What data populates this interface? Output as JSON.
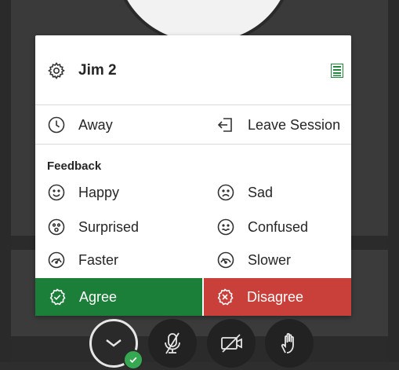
{
  "user": {
    "name": "Jim 2"
  },
  "status": {
    "away_label": "Away",
    "leave_label": "Leave Session"
  },
  "feedback": {
    "section_label": "Feedback",
    "items": [
      {
        "label": "Happy",
        "icon": "happy-icon"
      },
      {
        "label": "Sad",
        "icon": "sad-icon"
      },
      {
        "label": "Surprised",
        "icon": "surprised-icon"
      },
      {
        "label": "Confused",
        "icon": "confused-icon"
      },
      {
        "label": "Faster",
        "icon": "faster-icon"
      },
      {
        "label": "Slower",
        "icon": "slower-icon"
      }
    ],
    "agree_label": "Agree",
    "disagree_label": "Disagree"
  },
  "colors": {
    "agree": "#1b7f3a",
    "disagree": "#c9403a",
    "status_ok": "#36a852",
    "list_icon": "#1f8a3a"
  },
  "controls": {
    "status_button_icon": "chevron-down-icon",
    "mic_icon": "mic-off-icon",
    "camera_icon": "camera-off-icon",
    "share_icon": "hand-raise-icon"
  }
}
